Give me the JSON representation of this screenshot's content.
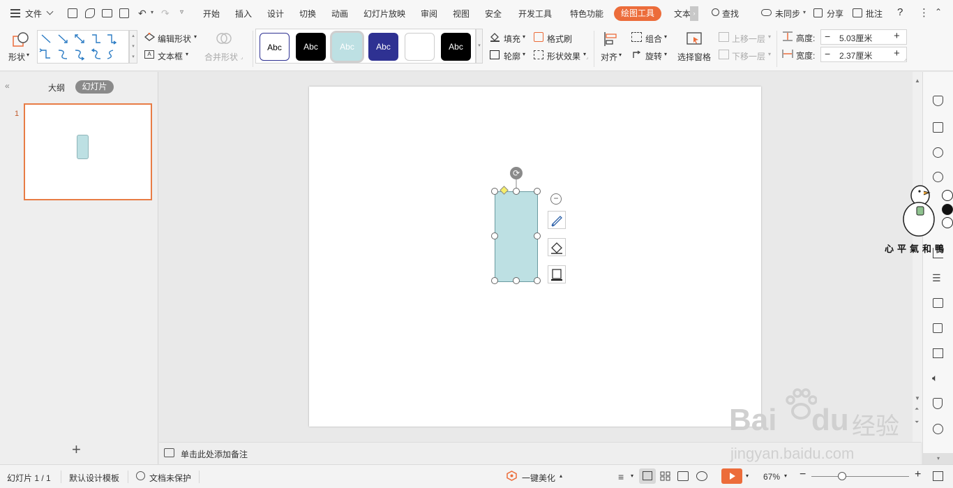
{
  "menubar": {
    "file": "文件",
    "tabs": [
      "开始",
      "插入",
      "设计",
      "切换",
      "动画",
      "幻灯片放映",
      "审阅",
      "视图",
      "安全",
      "开发工具",
      "特色功能"
    ],
    "active_tab": "绘图工具",
    "text_tab": "文本",
    "search": "查找",
    "sync": "未同步",
    "share": "分享",
    "comment": "批注",
    "help": "?"
  },
  "ribbon": {
    "shape": "形状",
    "edit_shape": "编辑形状",
    "text_box": "文本框",
    "merge_shape": "合并形状",
    "style_samples": [
      "Abc",
      "Abc",
      "Abc",
      "Abc",
      "",
      "Abc"
    ],
    "fill": "填充",
    "format_brush": "格式刷",
    "outline": "轮廓",
    "shape_effect": "形状效果",
    "align": "对齐",
    "group": "组合",
    "rotate": "旋转",
    "selection_pane": "选择窗格",
    "move_up": "上移一层",
    "move_down": "下移一层",
    "height_label": "高度:",
    "height_value": "5.03厘米",
    "width_label": "宽度:",
    "width_value": "2.37厘米",
    "minus": "−",
    "plus": "+"
  },
  "left_pane": {
    "outline_tab": "大纲",
    "slides_tab": "幻灯片",
    "slide_number": "1",
    "add": "+"
  },
  "notes": {
    "placeholder": "单击此处添加备注"
  },
  "status": {
    "slide_count": "幻灯片 1 / 1",
    "template": "默认设计模板",
    "protect": "文档未保护",
    "beautify": "一键美化",
    "zoom": "67%"
  },
  "watermark": {
    "brand": "Bai",
    "brand2": "du",
    "jingyan": "经验",
    "url": "jingyan.baidu.com",
    "sticker": "心平氣和鴨"
  },
  "colors": {
    "accent": "#ec6c3a",
    "shape_fill": "#bde0e3",
    "shape_border": "#6a9aa0",
    "style_navy": "#2e3192",
    "style_black": "#000000"
  }
}
